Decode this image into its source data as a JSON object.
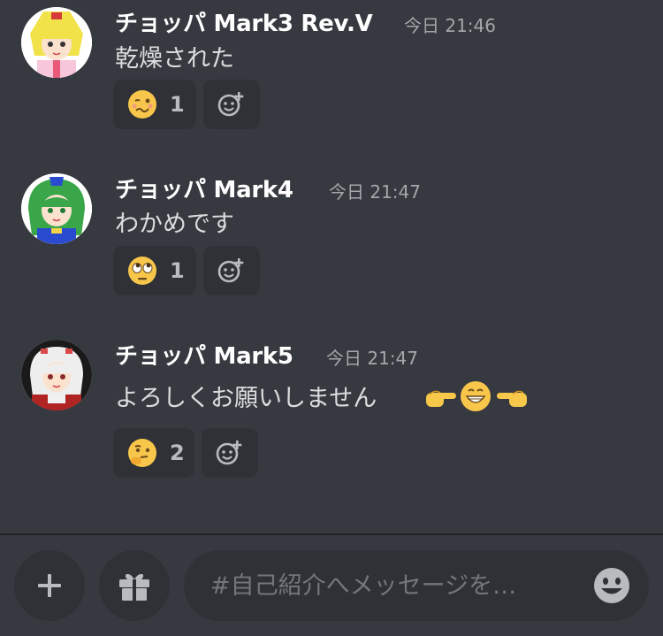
{
  "messages": [
    {
      "username": "チョッパ Mark3 Rev.V",
      "timestamp": "今日 21:46",
      "content": "乾燥された",
      "reaction": {
        "emoji": "woozy-face",
        "count": "1"
      }
    },
    {
      "username": "チョッパ Mark4",
      "timestamp": "今日 21:47",
      "content": "わかめです",
      "reaction": {
        "emoji": "rolling-eyes-face",
        "count": "1"
      }
    },
    {
      "username": "チョッパ Mark5",
      "timestamp": "今日 21:47",
      "content": "よろしくお願いしません",
      "reaction": {
        "emoji": "thinking-face",
        "count": "2"
      }
    }
  ],
  "composer": {
    "placeholder": "#自己紹介へメッセージを…"
  },
  "colors": {
    "background": "#36393f",
    "panel": "#2f3136",
    "username": "#ffffff",
    "timestamp": "#a3a6aa",
    "text": "#dcddde"
  }
}
